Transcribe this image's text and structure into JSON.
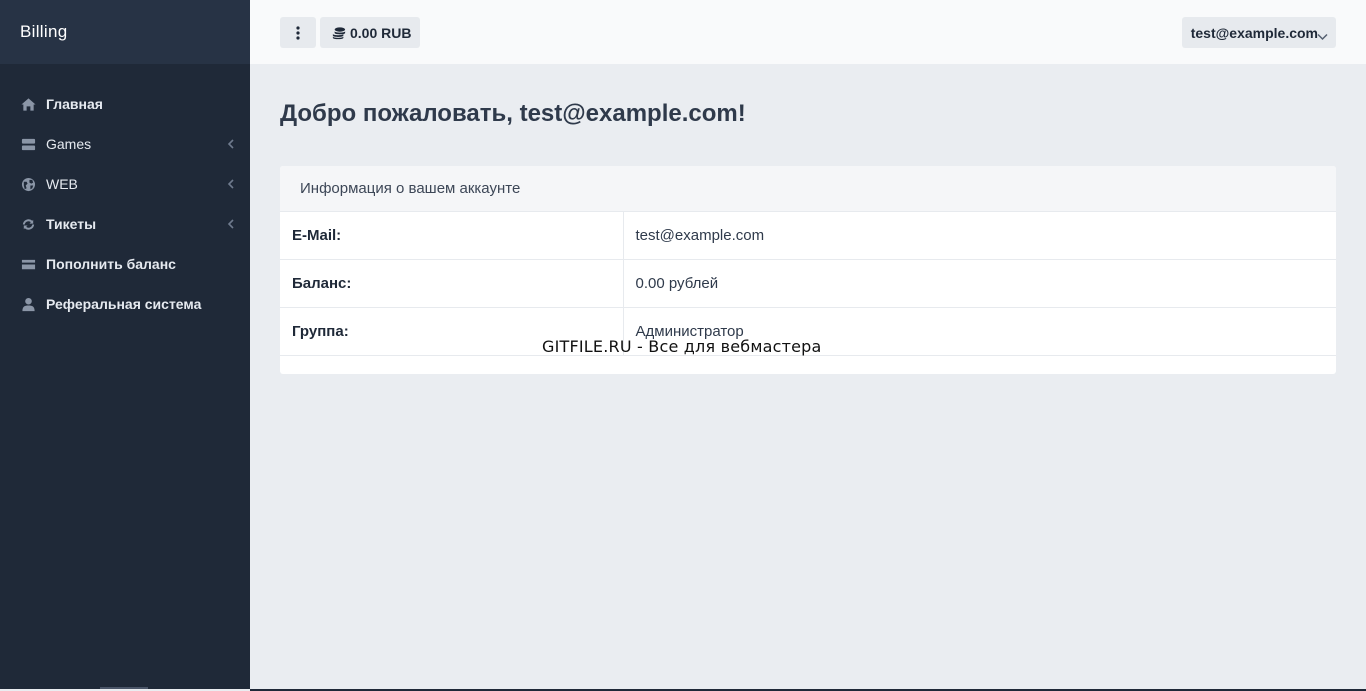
{
  "sidebar": {
    "brand": "Billing",
    "items": [
      {
        "label": "Главная",
        "icon": "home-icon",
        "bold": true,
        "submenu": false
      },
      {
        "label": "Games",
        "icon": "server-icon",
        "bold": false,
        "submenu": true
      },
      {
        "label": "WEB",
        "icon": "globe-icon",
        "bold": false,
        "submenu": true
      },
      {
        "label": "Тикеты",
        "icon": "refresh-icon",
        "bold": false,
        "submenu": true
      },
      {
        "label": "Пополнить баланс",
        "icon": "credit-card-icon",
        "bold": true,
        "submenu": false
      },
      {
        "label": "Реферальная система",
        "icon": "user-icon",
        "bold": true,
        "submenu": false
      }
    ]
  },
  "topbar": {
    "balance": "0.00 RUB",
    "user_email": "test@example.com"
  },
  "main": {
    "title": "Добро пожаловать, test@example.com!",
    "card": {
      "header": "Информация о вашем аккаунте",
      "rows": [
        {
          "key": "E-Mail:",
          "value": "test@example.com"
        },
        {
          "key": "Баланс:",
          "value": "0.00 рублей"
        },
        {
          "key": "Группа:",
          "value": "Администратор"
        }
      ]
    }
  },
  "watermark": "GITFILE.RU - Все для вебмастера",
  "colors": {
    "sidebar_bg": "#1f2938",
    "brand_bg": "#273345",
    "content_bg": "#eaedf1",
    "topbar_bg": "#f9fafb"
  }
}
